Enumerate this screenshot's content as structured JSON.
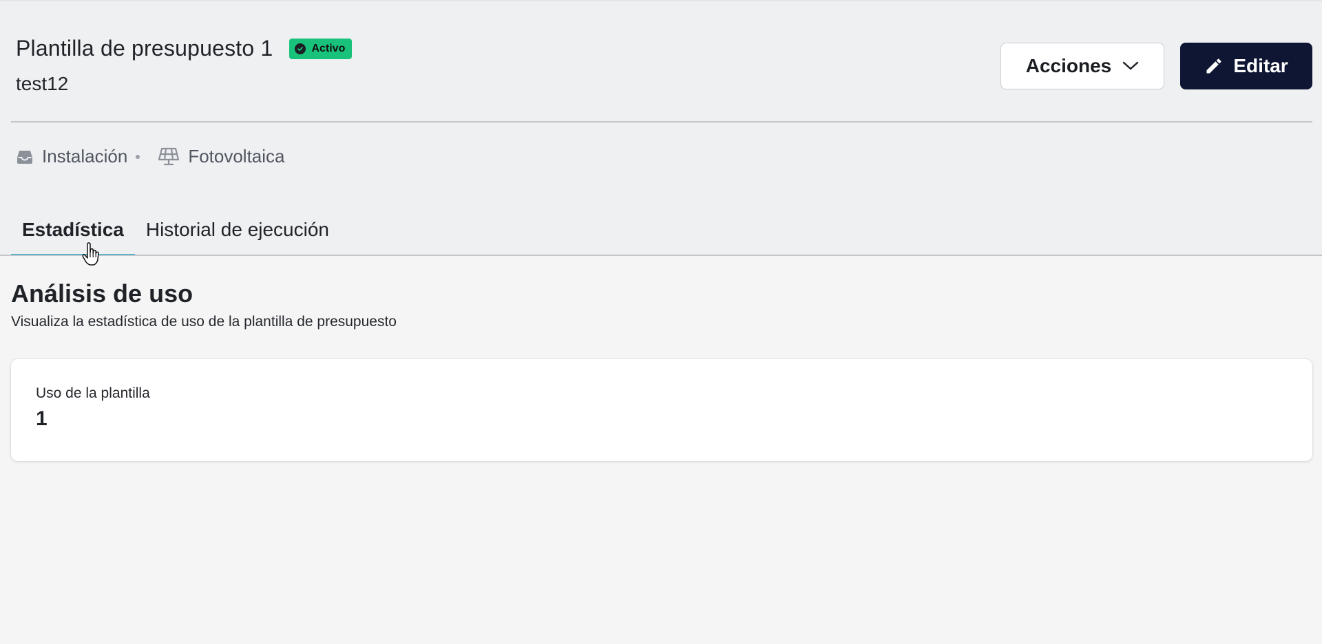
{
  "header": {
    "title": "Plantilla de presupuesto 1",
    "status": "Activo",
    "subtitle": "test12",
    "actions_label": "Acciones",
    "edit_label": "Editar"
  },
  "meta": {
    "category": "Instalación",
    "type": "Fotovoltaica"
  },
  "tabs": [
    {
      "label": "Estadística",
      "active": true
    },
    {
      "label": "Historial de ejecución",
      "active": false
    }
  ],
  "section": {
    "title": "Análisis de uso",
    "description": "Visualiza la estadística de uso de la plantilla de presupuesto"
  },
  "usage_card": {
    "label": "Uso de la plantilla",
    "value": "1"
  },
  "colors": {
    "status_badge": "#19c27a",
    "edit_button": "#0f1633",
    "active_tab_underline": "#20a4c9"
  }
}
